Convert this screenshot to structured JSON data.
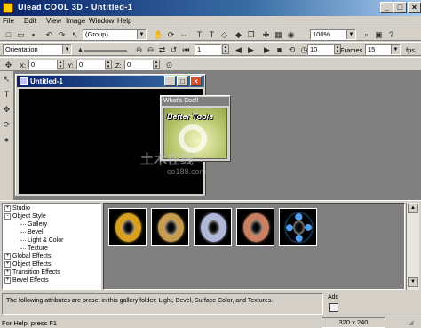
{
  "window": {
    "title": "Ulead COOL 3D - Untitled-1",
    "min": "_",
    "max": "□",
    "close": "×"
  },
  "menu": [
    "File",
    "Edit",
    "View",
    "Image",
    "Window",
    "Help"
  ],
  "toolbar1": {
    "object_select": "(Group)",
    "zoom": "100%"
  },
  "toolbar2": {
    "mode_select": "Orientation",
    "frame": "1",
    "frames_value": "10",
    "frames_label": "Frames",
    "fps_value": "15",
    "fps_label": "fps"
  },
  "toolbar3": {
    "x_label": "X:",
    "x_value": "0",
    "y_label": "Y:",
    "y_value": "0",
    "z_label": "Z:",
    "z_value": "0"
  },
  "document": {
    "title": "Untitled-1"
  },
  "whats_cool": {
    "title": "What's Cool!",
    "banner": "Better Tools"
  },
  "tree": [
    {
      "label": "Studio",
      "indent": 0,
      "toggle": "+"
    },
    {
      "label": "Object Style",
      "indent": 0,
      "toggle": "-"
    },
    {
      "label": "Gallery",
      "indent": 1,
      "toggle": ""
    },
    {
      "label": "Bevel",
      "indent": 1,
      "toggle": ""
    },
    {
      "label": "Light & Color",
      "indent": 1,
      "toggle": ""
    },
    {
      "label": "Texture",
      "indent": 1,
      "toggle": ""
    },
    {
      "label": "Global Effects",
      "indent": 0,
      "toggle": "+"
    },
    {
      "label": "Object Effects",
      "indent": 0,
      "toggle": "+"
    },
    {
      "label": "Transition Effects",
      "indent": 0,
      "toggle": "+"
    },
    {
      "label": "Bevel Effects",
      "indent": 0,
      "toggle": "+"
    }
  ],
  "gallery": [
    {
      "name": "gold-ring",
      "color": "#d8a020"
    },
    {
      "name": "brass-ring",
      "color": "#c89c50"
    },
    {
      "name": "chrome-ring",
      "color": "#b0b8d8"
    },
    {
      "name": "copper-ring",
      "color": "#c88060"
    },
    {
      "name": "blue-dotted-ring",
      "color": "#50a0f0"
    }
  ],
  "description": "The following attributes are preset in this gallery folder: Light, Bevel, Surface Color, and Textures.",
  "add_label": "Add",
  "status": {
    "help": "For Help, press F1",
    "size": "320 x 240"
  },
  "watermark": {
    "main": "土木在线",
    "sub": "co188.com"
  }
}
